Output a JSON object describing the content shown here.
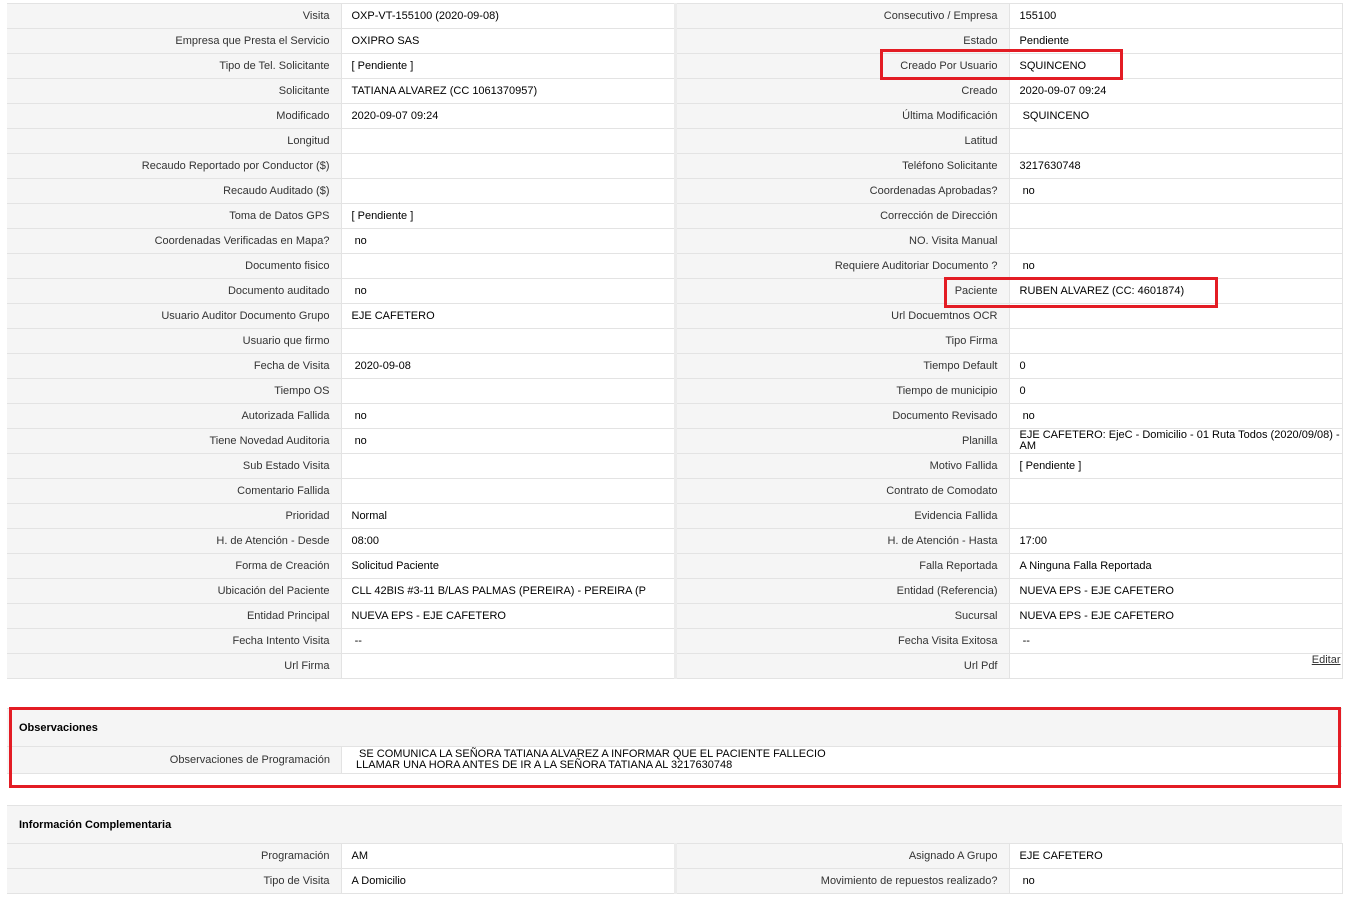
{
  "detail_rows": [
    {
      "l1": "Visita",
      "v1": "OXP-VT-155100 (2020-09-08)",
      "l2": "Consecutivo / Empresa",
      "v2": "155100"
    },
    {
      "l1": "Empresa que Presta el Servicio",
      "v1": "OXIPRO SAS",
      "l2": "Estado",
      "v2": "Pendiente"
    },
    {
      "l1": "Tipo de Tel. Solicitante",
      "v1": "[ Pendiente ]",
      "l2": "Creado Por Usuario",
      "v2": "SQUINCENO"
    },
    {
      "l1": "Solicitante",
      "v1": "TATIANA ALVAREZ (CC 1061370957)",
      "l2": "Creado",
      "v2": "2020-09-07 09:24"
    },
    {
      "l1": "Modificado",
      "v1": "2020-09-07 09:24",
      "l2": "Última Modificación",
      "v2": " SQUINCENO"
    },
    {
      "l1": "Longitud",
      "v1": "",
      "l2": "Latitud",
      "v2": ""
    },
    {
      "l1": "Recaudo Reportado por Conductor ($)",
      "v1": "",
      "l2": "Teléfono Solicitante",
      "v2": "3217630748"
    },
    {
      "l1": "Recaudo Auditado ($)",
      "v1": "",
      "l2": "Coordenadas Aprobadas?",
      "v2": " no"
    },
    {
      "l1": "Toma de Datos GPS",
      "v1": "[ Pendiente ]",
      "l2": "Corrección de Dirección",
      "v2": ""
    },
    {
      "l1": "Coordenadas Verificadas en Mapa?",
      "v1": " no",
      "l2": "NO. Visita Manual",
      "v2": ""
    },
    {
      "l1": "Documento fisico",
      "v1": "",
      "l2": "Requiere Auditoriar Documento ?",
      "v2": " no"
    },
    {
      "l1": "Documento auditado",
      "v1": " no",
      "l2": "Paciente",
      "v2": "RUBEN ALVAREZ (CC: 4601874)"
    },
    {
      "l1": "Usuario Auditor Documento Grupo",
      "v1": "EJE CAFETERO",
      "l2": "Url Docuemtnos OCR",
      "v2": ""
    },
    {
      "l1": "Usuario que firmo",
      "v1": "",
      "l2": "Tipo Firma",
      "v2": ""
    },
    {
      "l1": "Fecha de Visita",
      "v1": " 2020-09-08",
      "l2": "Tiempo Default",
      "v2": "0"
    },
    {
      "l1": "Tiempo OS",
      "v1": "",
      "l2": "Tiempo de municipio",
      "v2": "0"
    },
    {
      "l1": "Autorizada Fallida",
      "v1": " no",
      "l2": "Documento Revisado",
      "v2": " no"
    },
    {
      "l1": "Tiene Novedad Auditoria",
      "v1": " no",
      "l2": "Planilla",
      "v2": "EJE CAFETERO: EjeC - Domicilio - 01 Ruta Todos (2020/09/08) - AM"
    },
    {
      "l1": "Sub Estado Visita",
      "v1": "",
      "l2": "Motivo Fallida",
      "v2": "[ Pendiente ]"
    },
    {
      "l1": "Comentario Fallida",
      "v1": "",
      "l2": "Contrato de Comodato",
      "v2": ""
    },
    {
      "l1": "Prioridad",
      "v1": "Normal",
      "l2": "Evidencia Fallida",
      "v2": ""
    },
    {
      "l1": "H. de Atención - Desde",
      "v1": "08:00",
      "l2": "H. de Atención - Hasta",
      "v2": "17:00"
    },
    {
      "l1": "Forma de Creación",
      "v1": "Solicitud Paciente",
      "l2": "Falla Reportada",
      "v2": "A Ninguna Falla Reportada"
    },
    {
      "l1": "Ubicación del Paciente",
      "v1": "CLL 42BIS #3-11 B/LAS PALMAS (PEREIRA) - PEREIRA (P",
      "l2": "Entidad (Referencia)",
      "v2": "NUEVA EPS - EJE CAFETERO"
    },
    {
      "l1": "Entidad Principal",
      "v1": "NUEVA EPS - EJE CAFETERO",
      "l2": "Sucursal",
      "v2": "NUEVA EPS - EJE CAFETERO"
    },
    {
      "l1": "Fecha Intento Visita",
      "v1": " --",
      "l2": "Fecha Visita Exitosa",
      "v2": " --"
    },
    {
      "l1": "Url Firma",
      "v1": "",
      "l2": "Url Pdf",
      "v2": ""
    }
  ],
  "edit_link": "Editar",
  "observaciones": {
    "title": "Observaciones",
    "label": "Observaciones de Programación",
    "line1": " SE COMUNICA LA SEÑORA TATIANA ALVAREZ A INFORMAR QUE EL PACIENTE FALLECIO",
    "line2": "LLAMAR UNA HORA ANTES DE IR A LA SEÑORA TATIANA AL 3217630748"
  },
  "info": {
    "title": "Información Complementaria",
    "rows": [
      {
        "l1": "Programación",
        "v1": "AM",
        "l2": "Asignado A Grupo",
        "v2": "EJE CAFETERO"
      },
      {
        "l1": "Tipo de Visita",
        "v1": "A Domicilio",
        "l2": "Movimiento de repuestos realizado?",
        "v2": " no"
      }
    ]
  },
  "highlight_color": "#e31c24"
}
